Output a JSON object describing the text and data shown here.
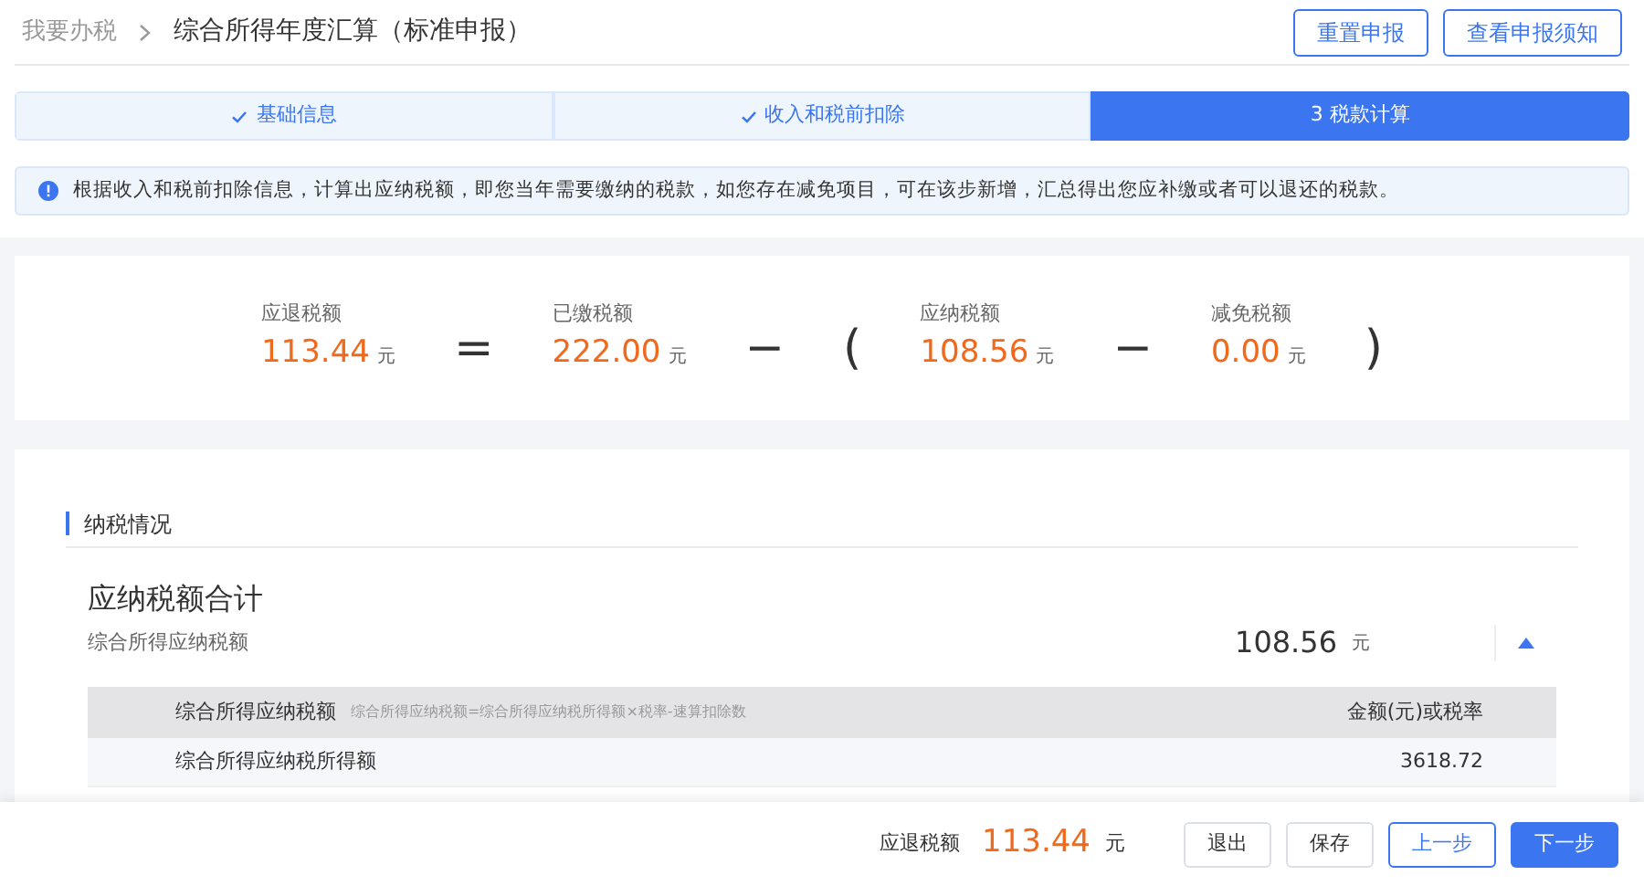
{
  "breadcrumb": [
    {
      "label": "我要办税",
      "current": false
    },
    {
      "label": "综合所得年度汇算（标准申报）",
      "current": true
    }
  ],
  "header_buttons": [
    "重置申报",
    "查看申报须知"
  ],
  "steps": [
    {
      "label": "基础信息",
      "done": true,
      "selected": false
    },
    {
      "label": "收入和税前扣除",
      "done": true,
      "selected": false
    },
    {
      "label": "3 税款计算",
      "done": false,
      "selected": true
    }
  ],
  "notice": "根据收入和税前扣除信息，计算出应纳税额，即您当年需要缴纳的税款，如您存在减免项目，可在该步新增，汇总得出您应补缴或者可以退还的税款。",
  "formula": [
    {
      "kind": "term",
      "label": "应退税额",
      "amount": "113.44",
      "unit": "元"
    },
    {
      "kind": "operator",
      "symbol": "="
    },
    {
      "kind": "term",
      "label": "已缴税额",
      "amount": "222.00",
      "unit": "元"
    },
    {
      "kind": "operator",
      "symbol": "−"
    },
    {
      "kind": "operator",
      "symbol": "("
    },
    {
      "kind": "term",
      "label": "应纳税额",
      "amount": "108.56",
      "unit": "元"
    },
    {
      "kind": "operator",
      "symbol": "−"
    },
    {
      "kind": "term",
      "label": "减免税额",
      "amount": "0.00",
      "unit": "元"
    },
    {
      "kind": "operator",
      "symbol": ")"
    }
  ],
  "section": {
    "title": "纳税情况",
    "summary_title": "应纳税额合计",
    "summary_subtitle": "综合所得应纳税额",
    "amount": "108.56",
    "unit": "元",
    "expanded": true,
    "table": {
      "columns": [
        "综合所得应纳税额",
        "金额(元)或税率"
      ],
      "formula_note": "综合所得应纳税额=综合所得应纳税所得额×税率-速算扣除数",
      "rows": [
        [
          "综合所得应纳税所得额",
          "3618.72"
        ]
      ]
    }
  },
  "footer": {
    "label": "应退税额",
    "amount": "113.44",
    "unit": "元",
    "buttons": [
      {
        "label": "退出",
        "kind": "default"
      },
      {
        "label": "保存",
        "kind": "default"
      },
      {
        "label": "上一步",
        "kind": "outline"
      },
      {
        "label": "下一步",
        "kind": "primary"
      }
    ]
  }
}
